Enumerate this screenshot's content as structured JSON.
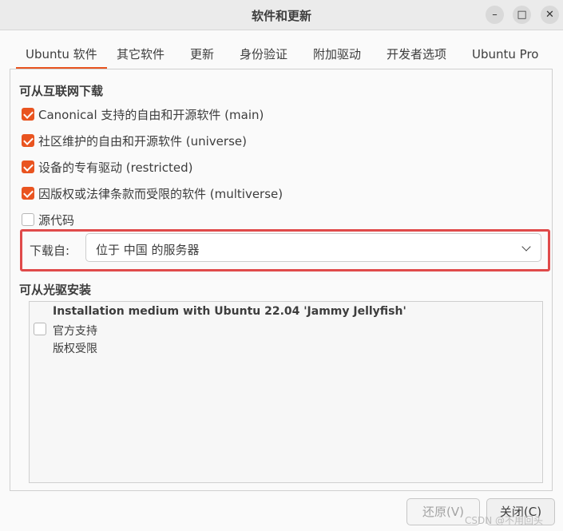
{
  "window": {
    "title": "软件和更新"
  },
  "tabs": [
    {
      "label": "Ubuntu 软件"
    },
    {
      "label": "其它软件"
    },
    {
      "label": "更新"
    },
    {
      "label": "身份验证"
    },
    {
      "label": "附加驱动"
    },
    {
      "label": "开发者选项"
    },
    {
      "label": "Ubuntu Pro"
    }
  ],
  "active_tab": "Ubuntu 软件",
  "internet": {
    "heading": "可从互联网下载",
    "options": [
      {
        "label": "Canonical 支持的自由和开源软件 (main)",
        "checked": true
      },
      {
        "label": "社区维护的自由和开源软件 (universe)",
        "checked": true
      },
      {
        "label": "设备的专有驱动 (restricted)",
        "checked": true
      },
      {
        "label": "因版权或法律条款而受限的软件 (multiverse)",
        "checked": true
      },
      {
        "label": "源代码",
        "checked": false
      }
    ],
    "download_from_label": "下载自:",
    "download_from_value": "位于 中国 的服务器"
  },
  "cdrom": {
    "heading": "可从光驱安装",
    "item": {
      "title": "Installation medium with Ubuntu 22.04 'Jammy Jellyfish'",
      "line1": "官方支持",
      "line2": "版权受限",
      "checked": false
    }
  },
  "buttons": {
    "revert": "还原(V)",
    "close": "关闭(C)"
  },
  "watermark": "CSDN @不用回头",
  "colors": {
    "accent": "#e95420",
    "highlight_border": "#e04a4a"
  }
}
